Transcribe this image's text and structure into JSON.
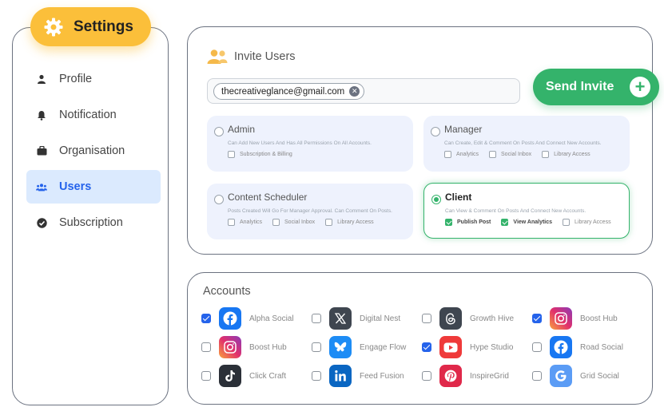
{
  "settings": {
    "title": "Settings",
    "icon": "gear-icon",
    "accent": "#fbbf3a"
  },
  "sidebar": {
    "items": [
      {
        "label": "Profile",
        "icon": "user-icon",
        "active": false
      },
      {
        "label": "Notification",
        "icon": "bell-icon",
        "active": false
      },
      {
        "label": "Organisation",
        "icon": "briefcase-icon",
        "active": false
      },
      {
        "label": "Users",
        "icon": "users-icon",
        "active": true
      },
      {
        "label": "Subscription",
        "icon": "check-circle-icon",
        "active": false
      }
    ]
  },
  "invite": {
    "title": "Invite Users",
    "email_chip": "thecreativeglance@gmail.com",
    "send_label": "Send Invite",
    "send_color": "#34b36b",
    "roles": [
      {
        "name": "Admin",
        "description": "Can Add New Users And Has All Permissions On All Accounts.",
        "selected": false,
        "permissions": [
          {
            "label": "Subscription & Billing",
            "checked": false
          }
        ]
      },
      {
        "name": "Manager",
        "description": "Can Create, Edit & Comment On Posts And Connect New Accounts.",
        "selected": false,
        "permissions": [
          {
            "label": "Analytics",
            "checked": false
          },
          {
            "label": "Social Inbox",
            "checked": false
          },
          {
            "label": "Library Access",
            "checked": false
          }
        ]
      },
      {
        "name": "Content Scheduler",
        "description": "Posts Created Will Go For Manager Approval. Can Comment On Posts.",
        "selected": false,
        "permissions": [
          {
            "label": "Analytics",
            "checked": false
          },
          {
            "label": "Social Inbox",
            "checked": false
          },
          {
            "label": "Library Access",
            "checked": false
          }
        ]
      },
      {
        "name": "Client",
        "description": "Can View & Comment On Posts And Connect New Accounts.",
        "selected": true,
        "permissions": [
          {
            "label": "Publish Post",
            "checked": true
          },
          {
            "label": "View Analytics",
            "checked": true
          },
          {
            "label": "Library Access",
            "checked": false
          }
        ]
      }
    ]
  },
  "accounts": {
    "title": "Accounts",
    "items": [
      {
        "name": "Alpha Social",
        "platform": "facebook-icon",
        "checked": true
      },
      {
        "name": "Digital Nest",
        "platform": "x-icon",
        "checked": false
      },
      {
        "name": "Growth Hive",
        "platform": "threads-icon",
        "checked": false
      },
      {
        "name": "Boost Hub",
        "platform": "instagram-icon",
        "checked": true
      },
      {
        "name": "Boost Hub",
        "platform": "instagram-icon",
        "checked": false
      },
      {
        "name": "Engage Flow",
        "platform": "bluesky-icon",
        "checked": false
      },
      {
        "name": "Hype Studio",
        "platform": "youtube-icon",
        "checked": true
      },
      {
        "name": "Road Social",
        "platform": "facebook-icon",
        "checked": false
      },
      {
        "name": "Click Craft",
        "platform": "tiktok-icon",
        "checked": false
      },
      {
        "name": "Feed Fusion",
        "platform": "linkedin-icon",
        "checked": false
      },
      {
        "name": "InspireGrid",
        "platform": "pinterest-icon",
        "checked": false
      },
      {
        "name": "Grid Social",
        "platform": "google-icon",
        "checked": false
      }
    ]
  }
}
